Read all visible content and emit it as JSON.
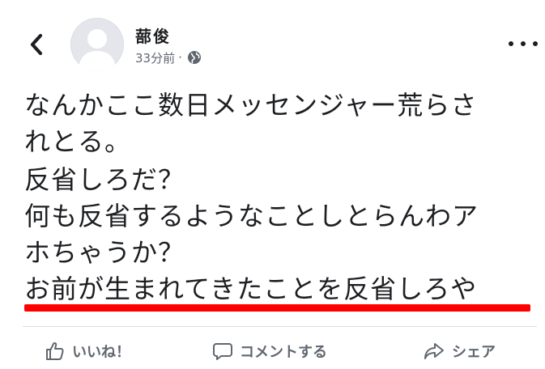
{
  "post": {
    "author": "蔀俊",
    "timestamp": "33分前",
    "separator": "·",
    "privacy_icon": "globe-icon",
    "body_lines": [
      "なんかここ数日メッセンジャー荒らさ",
      "れとる。",
      "反省しろだ？",
      "何も反省するようなことしとらんわア",
      "ホちゃうか？",
      "お前が生まれてきたことを反省しろや"
    ]
  },
  "actions": {
    "like_label": "いいね！",
    "comment_label": "コメントする",
    "share_label": "シェア"
  },
  "colors": {
    "text": "#1c1e21",
    "secondary": "#606770",
    "underline": "#ff0000"
  }
}
